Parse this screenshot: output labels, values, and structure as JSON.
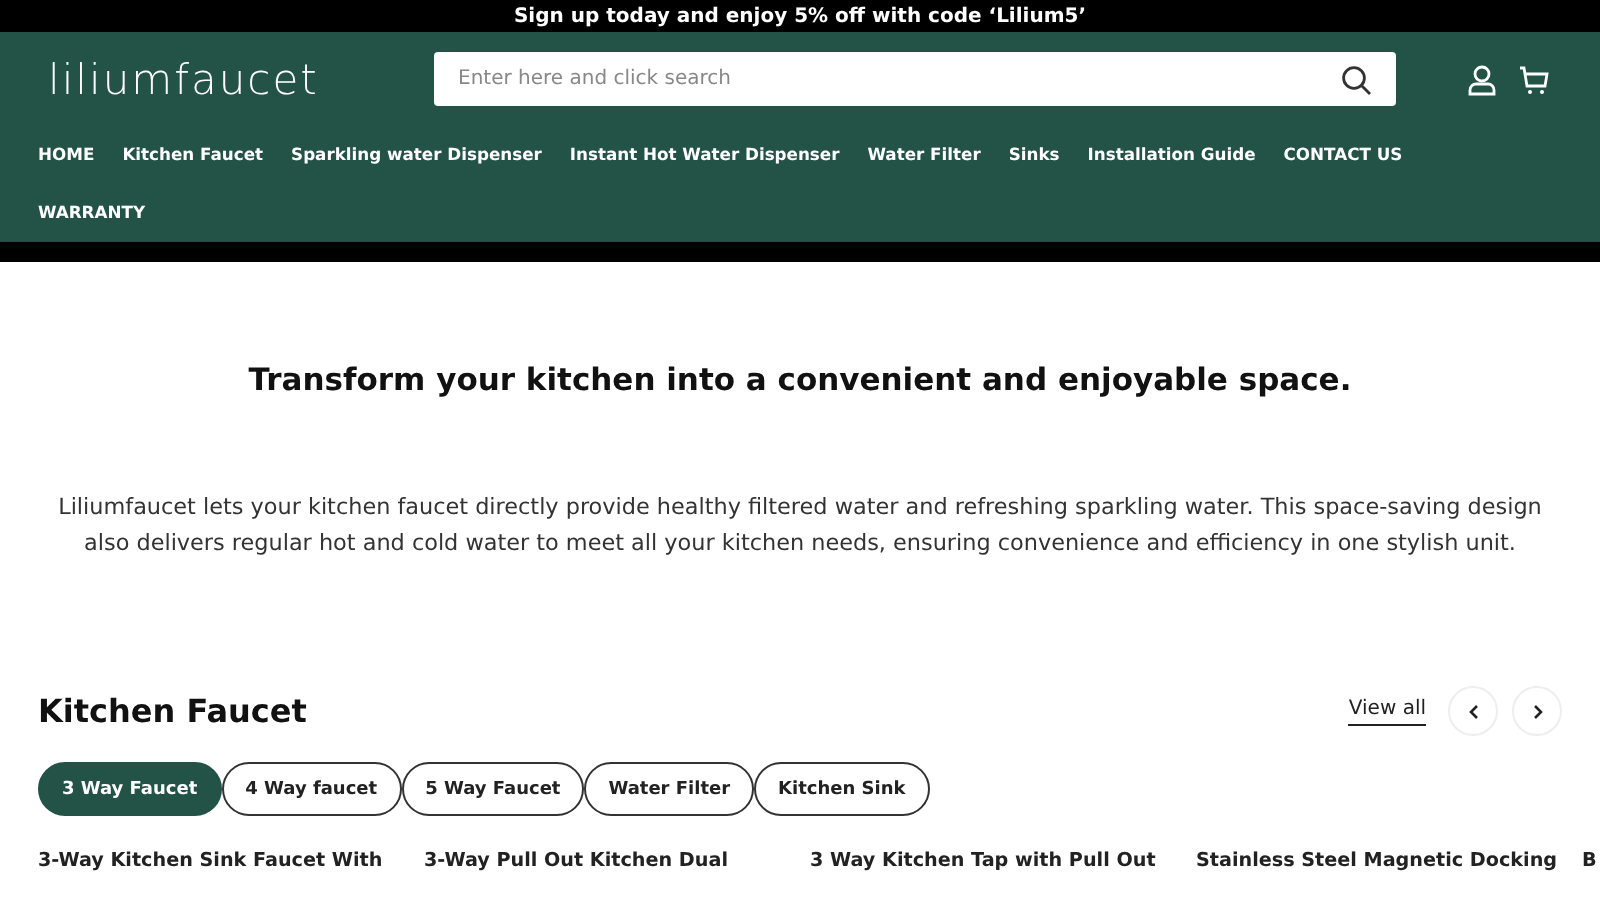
{
  "announcement": "Sign up today and enjoy 5% off with code ‘Lilium5’",
  "header": {
    "logo": "liliumfaucet",
    "search": {
      "placeholder": "Enter here and click search"
    }
  },
  "nav": [
    "HOME",
    "Kitchen Faucet",
    "Sparkling water Dispenser",
    "Instant Hot Water Dispenser",
    "Water Filter",
    "Sinks",
    "Installation Guide",
    "CONTACT US",
    "WARRANTY"
  ],
  "hero": {
    "title": "Transform your kitchen into a convenient and enjoyable space.",
    "text": "Liliumfaucet lets your kitchen faucet directly provide healthy filtered water and refreshing sparkling water. This space-saving design also delivers regular hot and cold water to meet all your kitchen needs, ensuring convenience and efficiency in one stylish unit."
  },
  "section": {
    "title": "Kitchen Faucet",
    "view_all": "View all",
    "tabs": [
      {
        "label": "3 Way Faucet",
        "selected": true
      },
      {
        "label": "4 Way faucet",
        "selected": false
      },
      {
        "label": "5 Way Faucet",
        "selected": false
      },
      {
        "label": "Water Filter",
        "selected": false
      },
      {
        "label": "Kitchen Sink",
        "selected": false
      }
    ],
    "products": [
      "3-Way Kitchen Sink Faucet With",
      "3-Way Pull Out Kitchen Dual",
      "3 Way Kitchen Tap with Pull Out",
      "Stainless Steel Magnetic Docking",
      "B"
    ]
  }
}
